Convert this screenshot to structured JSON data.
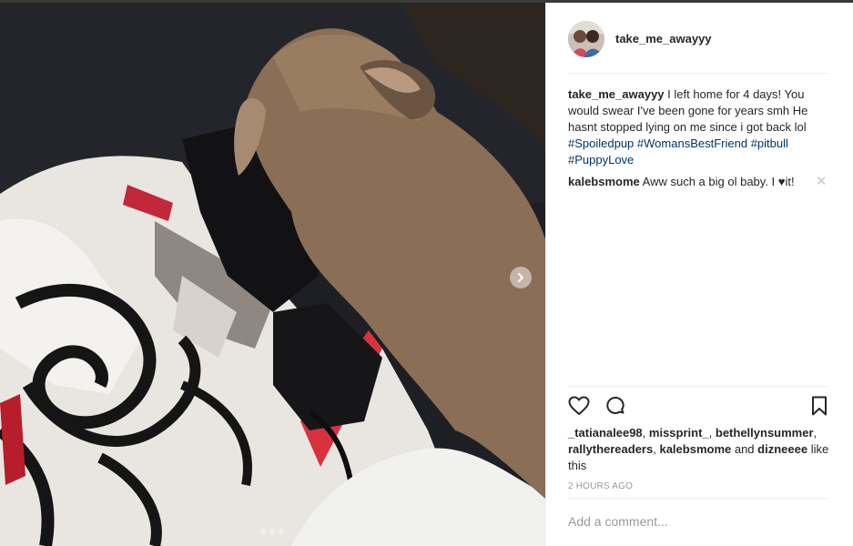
{
  "post": {
    "author": "take_me_awayyy",
    "caption_user": "take_me_awayyy",
    "caption_text": " I left home for 4 days! You would swear I've been gone for years smh He hasnt stopped lying on me since i got back lol ",
    "hashtags": [
      "#Spoiledpup",
      "#WomansBestFriend",
      "#pitbull",
      "#PuppyLove"
    ],
    "comments": [
      {
        "user": "kalebsmome",
        "text": " Aww such a big ol baby. I ♥it!"
      }
    ],
    "likes": {
      "users": [
        "_tatianalee98",
        "missprint_",
        "bethellynsummer",
        "rallythereaders",
        "kalebsmome"
      ],
      "and_text": " and ",
      "last_user": "dizneeee",
      "suffix": " like this"
    },
    "time": "2 HOURS AGO",
    "comment_placeholder": "Add a comment..."
  },
  "carousel": {
    "count": 3,
    "active_index": 0
  },
  "icons": {
    "next": "chevron-right-icon",
    "like": "heart-icon",
    "comment": "comment-icon",
    "save": "bookmark-icon",
    "close": "close-icon"
  },
  "colors": {
    "hashtag": "#003569",
    "text": "#262626",
    "muted": "#999999"
  }
}
